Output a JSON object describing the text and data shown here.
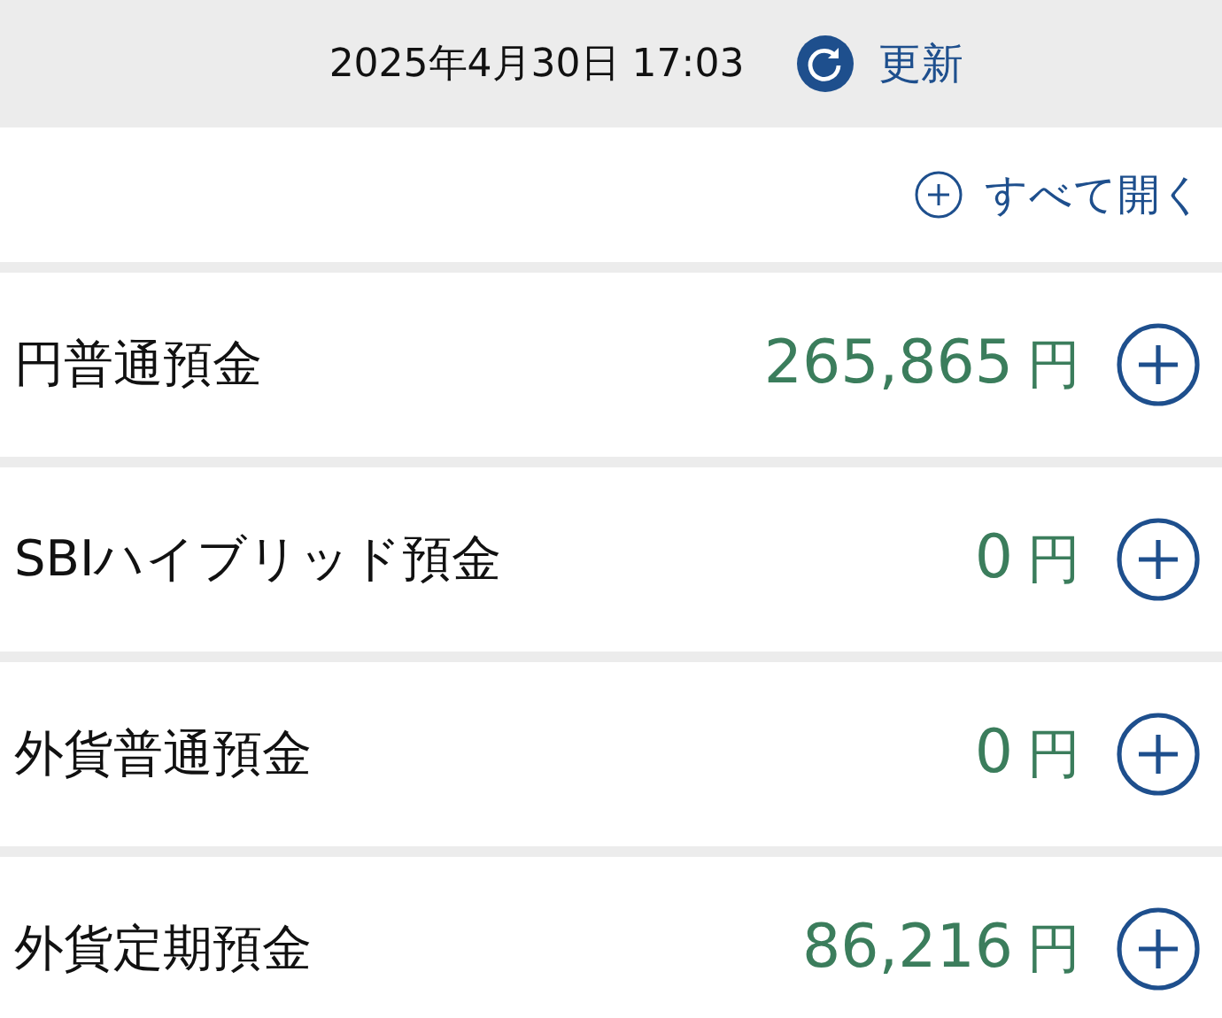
{
  "header": {
    "datetime": "2025年4月30日 17:03",
    "refresh_label": "更新"
  },
  "expand_all": {
    "label": "すべて開く"
  },
  "accounts": [
    {
      "name": "円普通預金",
      "amount": "265,865",
      "unit": "円"
    },
    {
      "name": "SBIハイブリッド預金",
      "amount": "0",
      "unit": "円"
    },
    {
      "name": "外貨普通預金",
      "amount": "0",
      "unit": "円"
    },
    {
      "name": "外貨定期預金",
      "amount": "86,216",
      "unit": "円"
    }
  ]
}
